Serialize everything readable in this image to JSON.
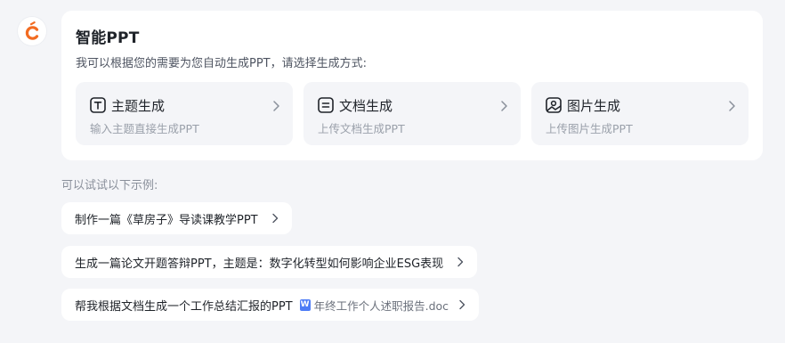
{
  "brand": {
    "avatar_icon": "doubao-c-logo-icon",
    "accent": "#f26b21"
  },
  "card": {
    "title": "智能PPT",
    "description": "我可以根据您的需要为您自动生成PPT，请选择生成方式:",
    "options": [
      {
        "icon": "topic-t-icon",
        "title": "主题生成",
        "subtitle": "输入主题直接生成PPT"
      },
      {
        "icon": "document-icon",
        "title": "文档生成",
        "subtitle": "上传文档生成PPT"
      },
      {
        "icon": "image-icon",
        "title": "图片生成",
        "subtitle": "上传图片生成PPT"
      }
    ]
  },
  "examples": {
    "label": "可以试试以下示例:",
    "items": [
      {
        "text": "制作一篇《草房子》导读课教学PPT"
      },
      {
        "text": "生成一篇论文开题答辩PPT，主题是：数字化转型如何影响企业ESG表现"
      },
      {
        "text": "帮我根据文档生成一个工作总结汇报的PPT",
        "file_icon": "W",
        "file_name": "年终工作个人述职报告.doc"
      }
    ]
  }
}
